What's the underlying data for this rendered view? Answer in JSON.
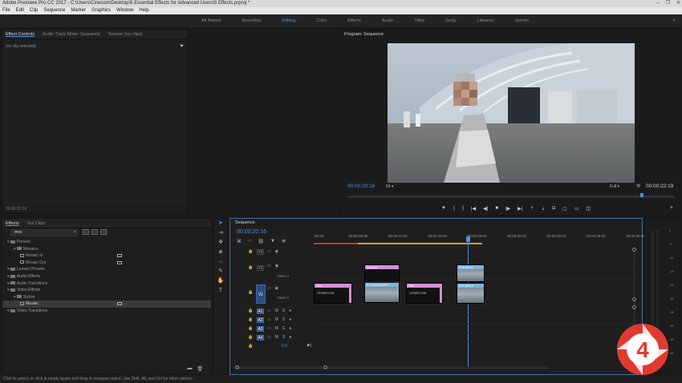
{
  "window": {
    "title": "Adobe Premiere Pro CC 2017 - C:\\Users\\Cinecom\\Desktop\\5 Essential Effects for Advanced Users\\5 Effects.prproj *",
    "controls": [
      "–",
      "❐",
      "✕"
    ]
  },
  "menu": [
    "File",
    "Edit",
    "Clip",
    "Sequence",
    "Marker",
    "Graphics",
    "Window",
    "Help"
  ],
  "workspaces": {
    "items": [
      "All Panels",
      "Assembly",
      "Editing",
      "Color",
      "Effects",
      "Audio",
      "Titles",
      "Jordy",
      "Libraries",
      "Jasmin"
    ],
    "active": "Editing",
    "more": "»"
  },
  "effect_controls": {
    "tabs": [
      "Effect Controls",
      "Audio Track Mixer: Sequence",
      "Source: (no clips)"
    ],
    "active_tab": "Effect Controls",
    "no_clip": "(no clip selected)",
    "timecode": "00:00:20:16"
  },
  "program_monitor": {
    "title": "Program: Sequence",
    "timecode_current": "00:00:20:16",
    "fit": "Fit",
    "resolution": "Full",
    "timecode_duration": "00:00:22:19"
  },
  "effects_panel": {
    "tabs": [
      "Effects",
      "Gui Clips"
    ],
    "active_tab": "Effects",
    "search_value": "mos",
    "tree": [
      {
        "label": "Presets",
        "level": 0,
        "type": "folder",
        "badge": false
      },
      {
        "label": "Mosaics",
        "level": 1,
        "type": "folder",
        "badge": false
      },
      {
        "label": "Mosaic In",
        "level": 2,
        "type": "fx",
        "badge": true
      },
      {
        "label": "Mosaic Out",
        "level": 2,
        "type": "fx",
        "badge": true
      },
      {
        "label": "Lumetri Presets",
        "level": 0,
        "type": "folder",
        "badge": false
      },
      {
        "label": "Audio Effects",
        "level": 0,
        "type": "folder",
        "badge": false
      },
      {
        "label": "Audio Transitions",
        "level": 0,
        "type": "folder",
        "badge": false
      },
      {
        "label": "Video Effects",
        "level": 0,
        "type": "folder",
        "badge": false
      },
      {
        "label": "Stylize",
        "level": 1,
        "type": "folder",
        "badge": false
      },
      {
        "label": "Mosaic",
        "level": 2,
        "type": "fx",
        "badge": true,
        "selected": true
      },
      {
        "label": "Video Transitions",
        "level": 0,
        "type": "folder",
        "badge": false
      }
    ]
  },
  "timeline": {
    "tab": "Sequence",
    "timecode": "00:00:20:16",
    "ruler_ticks": [
      ":00:00",
      "00:00:05:00",
      "00:00:10:00",
      "00:00:15:00",
      "00:00:20:00",
      "00:00:25:00",
      "00:00:30:00",
      "00:00:35:00",
      "00:00:40:00"
    ],
    "video_tracks": [
      {
        "name": "V3",
        "label": "",
        "active": false
      },
      {
        "name": "V2",
        "label": "Video 2",
        "active": false
      },
      {
        "name": "V1",
        "label": "Video 1",
        "active": true
      }
    ],
    "audio_tracks": [
      "A1",
      "A2",
      "A3",
      "A4"
    ],
    "master_value": "0.0",
    "clips": {
      "v2_graphic": "Graphic",
      "v2_graphic_file": "P1140542.MP4",
      "v2_video_file": "P1140532",
      "v1_title1": "Title",
      "v1_title2": "Title",
      "v1_video_file": "P1140532",
      "credit_text": "CINECOM"
    }
  },
  "audio_meters": {
    "labels": [
      "0",
      "-6",
      "-12",
      "-18",
      "-24",
      "-30",
      "-36",
      "-42",
      "-48",
      "-54"
    ]
  },
  "status_bar": "Click to select, or click in empty space and drag to marquee select. Use Shift, Alt, and Ctrl for other options.",
  "brand": {
    "number": "4"
  },
  "colors": {
    "accent": "#4a8ef0",
    "clip_pink": "#d58fd6",
    "clip_blue": "#7cb3d9",
    "brand_red": "#e03a30"
  }
}
